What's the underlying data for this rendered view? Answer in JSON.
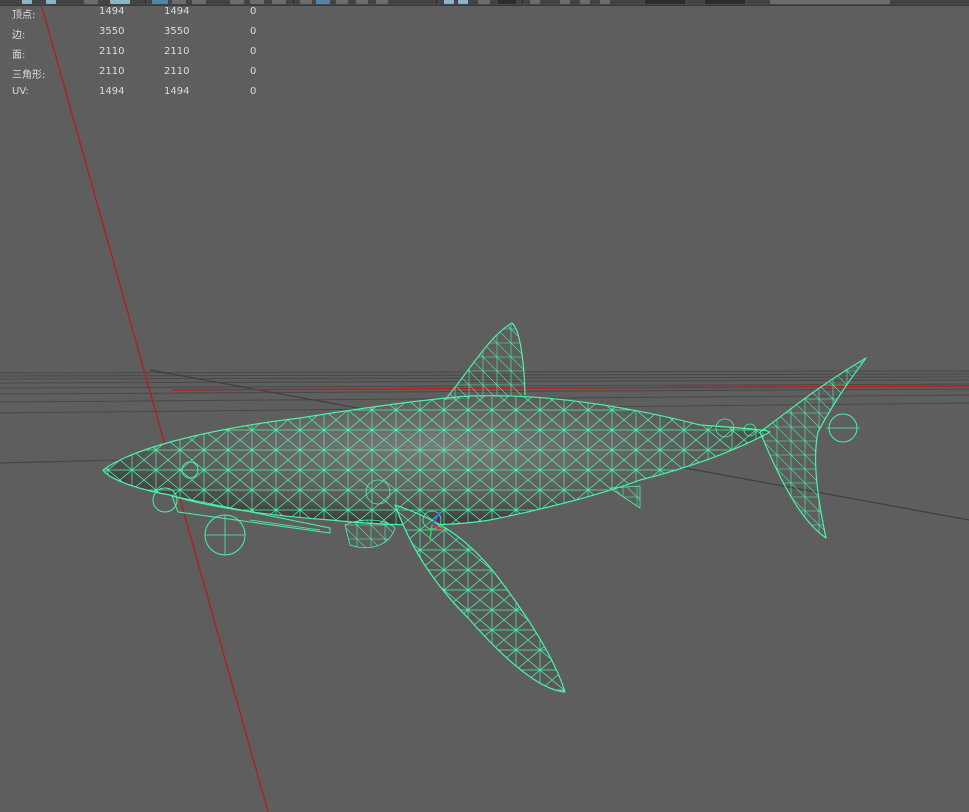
{
  "hud": {
    "rows": [
      {
        "label": "顶点:",
        "total": "1494",
        "selected": "1494",
        "extra": "0"
      },
      {
        "label": "边:",
        "total": "3550",
        "selected": "3550",
        "extra": "0"
      },
      {
        "label": "面:",
        "total": "2110",
        "selected": "2110",
        "extra": "0"
      },
      {
        "label": "三角形:",
        "total": "2110",
        "selected": "2110",
        "extra": "0"
      },
      {
        "label": "UV:",
        "total": "1494",
        "selected": "1494",
        "extra": "0"
      }
    ]
  },
  "colors": {
    "viewport_bg": "#5e5e5e",
    "wireframe": "#4cf2a8",
    "axis_x": "#c01818",
    "grid": "#474747"
  },
  "icons": [
    "select-tool-icon",
    "wireframe-mode-icon",
    "shaded-mode-icon",
    "grid-toggle-icon",
    "camera-icon",
    "lighting-icon"
  ]
}
